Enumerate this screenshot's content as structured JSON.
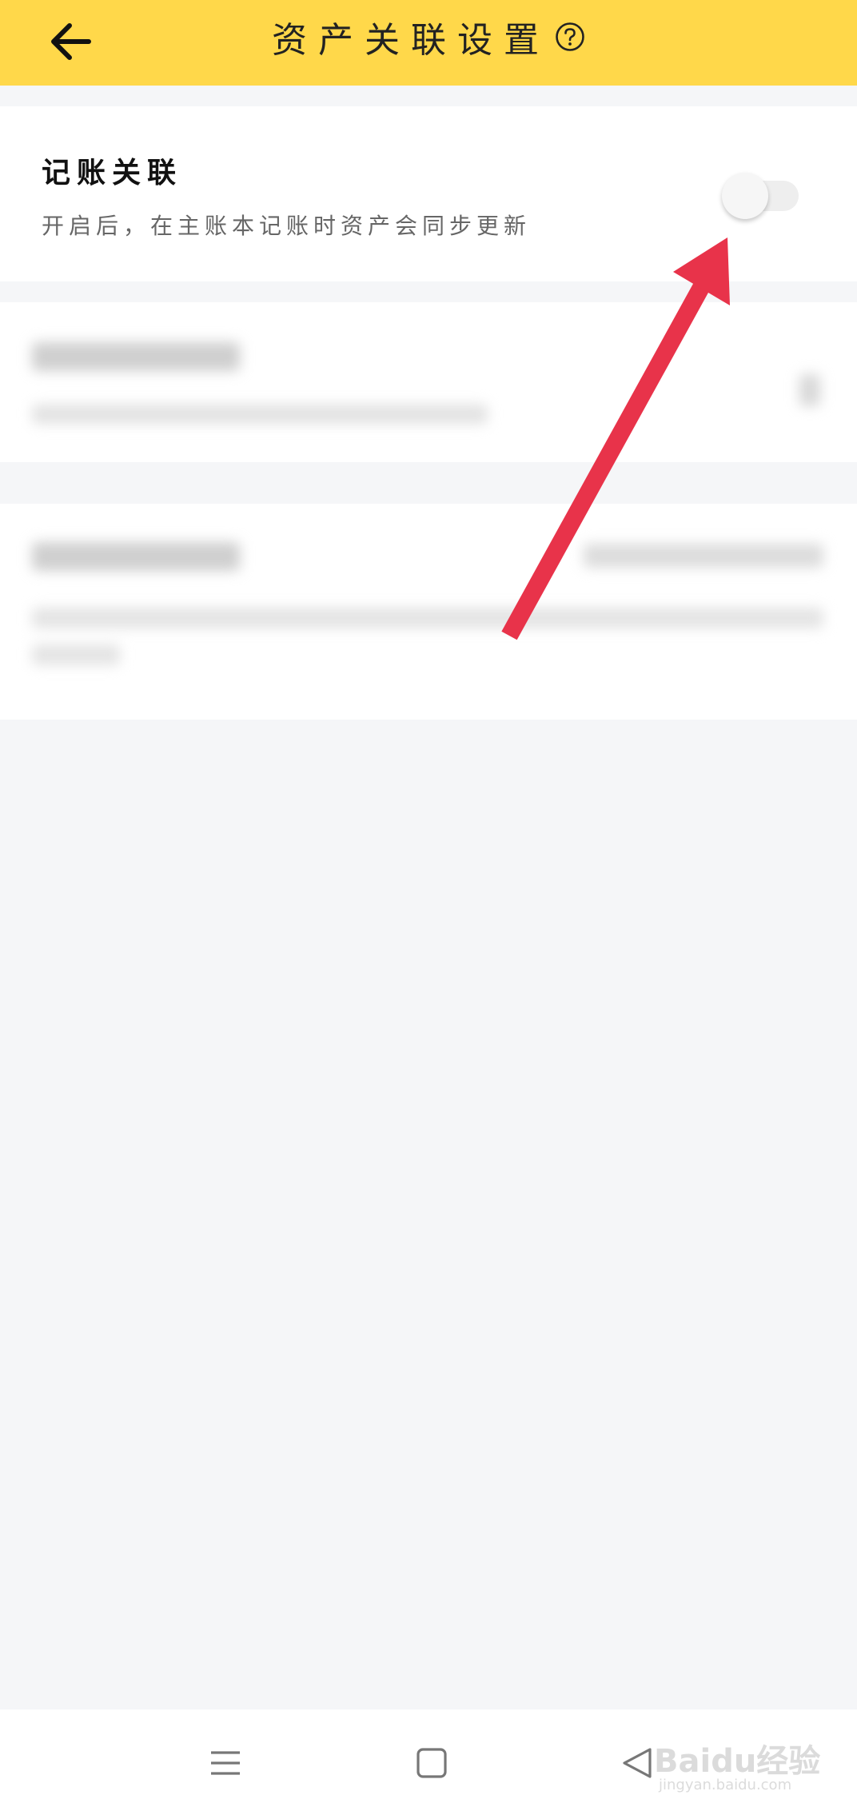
{
  "header": {
    "title": "资产关联设置",
    "back_icon": "arrow-left-icon",
    "help_icon": "question-circle-icon",
    "background_color": "#ffd84a"
  },
  "settings": {
    "bookkeeping_link": {
      "title": "记账关联",
      "description": "开启后，在主账本记账时资产会同步更新",
      "toggle_on": false
    }
  },
  "annotation": {
    "arrow_color": "#e8334a"
  },
  "navbar": {
    "menu_icon": "menu-icon",
    "home_icon": "square-home-icon",
    "back_icon": "triangle-back-icon"
  },
  "watermark": {
    "text": "Baidu经验",
    "url": "jingyan.baidu.com"
  }
}
